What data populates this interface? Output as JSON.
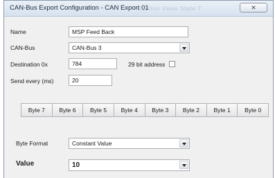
{
  "window": {
    "title": "CAN-Bus Export Configuration - CAN Export 01",
    "ghost_title": "Caption Value   State 7",
    "close_glyph": "✕"
  },
  "form": {
    "name_label": "Name",
    "name_value": "MSP Feed Back",
    "canbus_label": "CAN-Bus",
    "canbus_value": "CAN-Bus 3",
    "destination_label": "Destination 0x",
    "destination_value": "784",
    "bit29_label": "29 bit address",
    "bit29_checked": false,
    "send_every_label": "Send every (ms)",
    "send_every_value": "20"
  },
  "bytes": [
    "Byte 7",
    "Byte 6",
    "Byte 5",
    "Byte 4",
    "Byte 3",
    "Byte 2",
    "Byte 1",
    "Byte 0"
  ],
  "byte_format": {
    "label": "Byte Format",
    "value": "Constant Value"
  },
  "value": {
    "label": "Value",
    "value": "10"
  },
  "icons": {
    "close": "close-icon",
    "dropdown": "chevron-down-icon"
  }
}
